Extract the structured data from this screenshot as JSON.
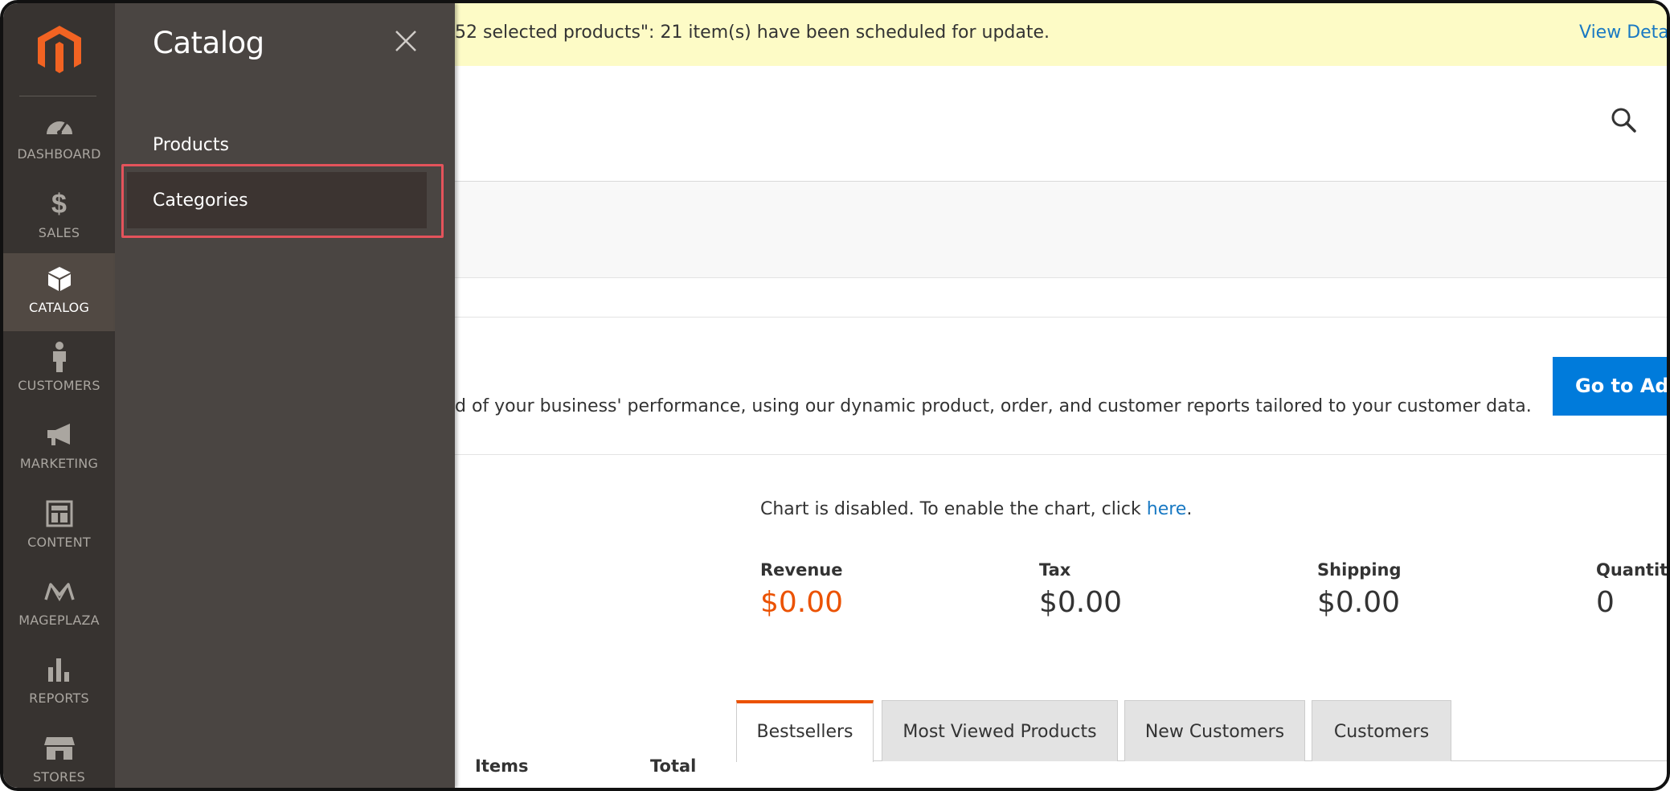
{
  "nav": {
    "items": [
      {
        "label": "DASHBOARD",
        "icon": "dashboard-icon"
      },
      {
        "label": "SALES",
        "icon": "dollar-icon"
      },
      {
        "label": "CATALOG",
        "icon": "box-icon",
        "active": true
      },
      {
        "label": "CUSTOMERS",
        "icon": "person-icon"
      },
      {
        "label": "MARKETING",
        "icon": "megaphone-icon"
      },
      {
        "label": "CONTENT",
        "icon": "layout-icon"
      },
      {
        "label": "MAGEPLAZA",
        "icon": "mageplaza-icon"
      },
      {
        "label": "REPORTS",
        "icon": "bar-chart-icon"
      },
      {
        "label": "STORES",
        "icon": "store-icon"
      }
    ]
  },
  "flyout": {
    "title": "Catalog",
    "links": [
      "Products",
      "Categories"
    ],
    "highlighted": "Categories"
  },
  "banner": {
    "message": "52 selected products\": 21 item(s) have been scheduled for update.",
    "link": "View Detail"
  },
  "advanced": {
    "text": "d of your business' performance, using our dynamic product, order, and customer reports tailored to your customer data.",
    "button": "Go to Adv"
  },
  "chart": {
    "message_prefix": "Chart is disabled. To enable the chart, click ",
    "message_link": "here",
    "message_suffix": "."
  },
  "stats": [
    {
      "label": "Revenue",
      "value": "$0.00"
    },
    {
      "label": "Tax",
      "value": "$0.00"
    },
    {
      "label": "Shipping",
      "value": "$0.00"
    },
    {
      "label": "Quantity",
      "value": "0"
    }
  ],
  "tabs": [
    "Bestsellers",
    "Most Viewed Products",
    "New Customers",
    "Customers"
  ],
  "columns": [
    "Items",
    "Total"
  ],
  "colors": {
    "nav_bg": "#373330",
    "flyout_bg": "#4a4542",
    "accent_orange": "#eb5202",
    "link_blue": "#1979c3",
    "button_blue": "#007bdb",
    "highlight_red": "#e4535b"
  }
}
